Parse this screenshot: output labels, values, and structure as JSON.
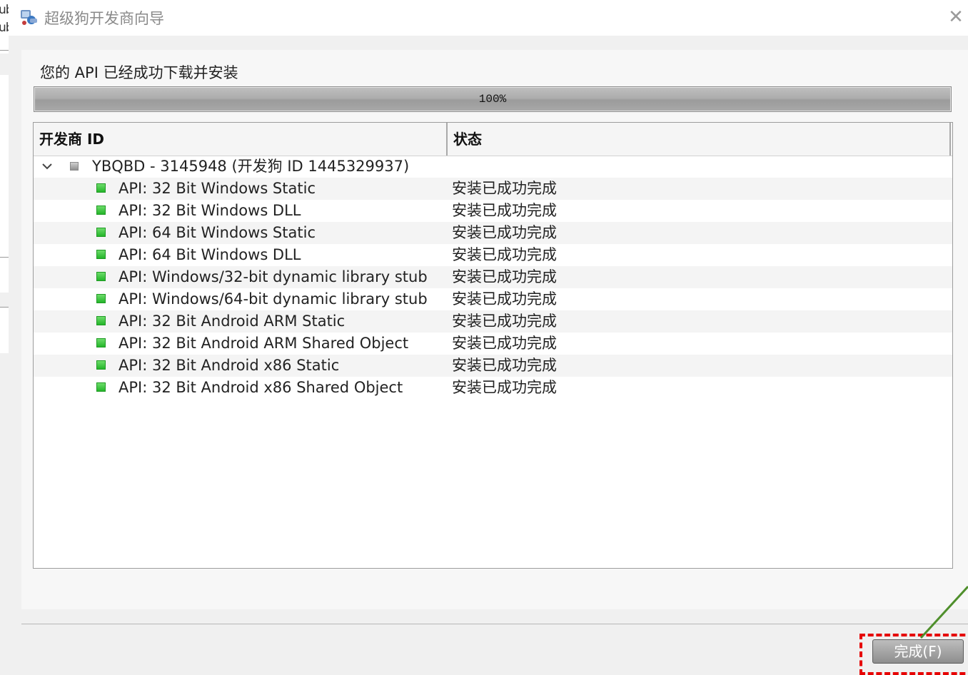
{
  "background_window": {
    "fragments": [
      "ub",
      "ub"
    ]
  },
  "window": {
    "title": "超级狗开发商向导",
    "close_glyph": "✕"
  },
  "message": "您的 API 已经成功下载并安装",
  "progress": {
    "value": 1.0,
    "label": "100%"
  },
  "tree": {
    "columns": [
      "开发商 ID",
      "状态"
    ],
    "parent": {
      "label": "YBQBD - 3145948 (开发狗 ID 1445329937)",
      "expanded": true
    },
    "items": [
      {
        "name": "API:  32 Bit Windows Static",
        "status": "安装已成功完成"
      },
      {
        "name": "API:  32 Bit Windows DLL",
        "status": "安装已成功完成"
      },
      {
        "name": "API:  64 Bit Windows Static",
        "status": "安装已成功完成"
      },
      {
        "name": "API:  64 Bit Windows DLL",
        "status": "安装已成功完成"
      },
      {
        "name": "API:  Windows/32-bit dynamic library stub",
        "status": "安装已成功完成"
      },
      {
        "name": "API:  Windows/64-bit dynamic library stub",
        "status": "安装已成功完成"
      },
      {
        "name": "API:  32 Bit Android ARM Static",
        "status": "安装已成功完成"
      },
      {
        "name": "API:  32 Bit Android ARM Shared Object",
        "status": "安装已成功完成"
      },
      {
        "name": "API:  32 Bit Android x86 Static",
        "status": "安装已成功完成"
      },
      {
        "name": "API:  32 Bit Android x86 Shared Object",
        "status": "安装已成功完成"
      }
    ]
  },
  "footer": {
    "finish_label": "完成(F)"
  },
  "colors": {
    "ok": "#2fbf35",
    "highlight": "#e60000",
    "arrow": "#4f8f2c"
  },
  "icons": {
    "app": "superdog-wizard-icon",
    "expander": "chevron-down-icon",
    "node": "key-node-icon",
    "item": "green-status-icon"
  }
}
